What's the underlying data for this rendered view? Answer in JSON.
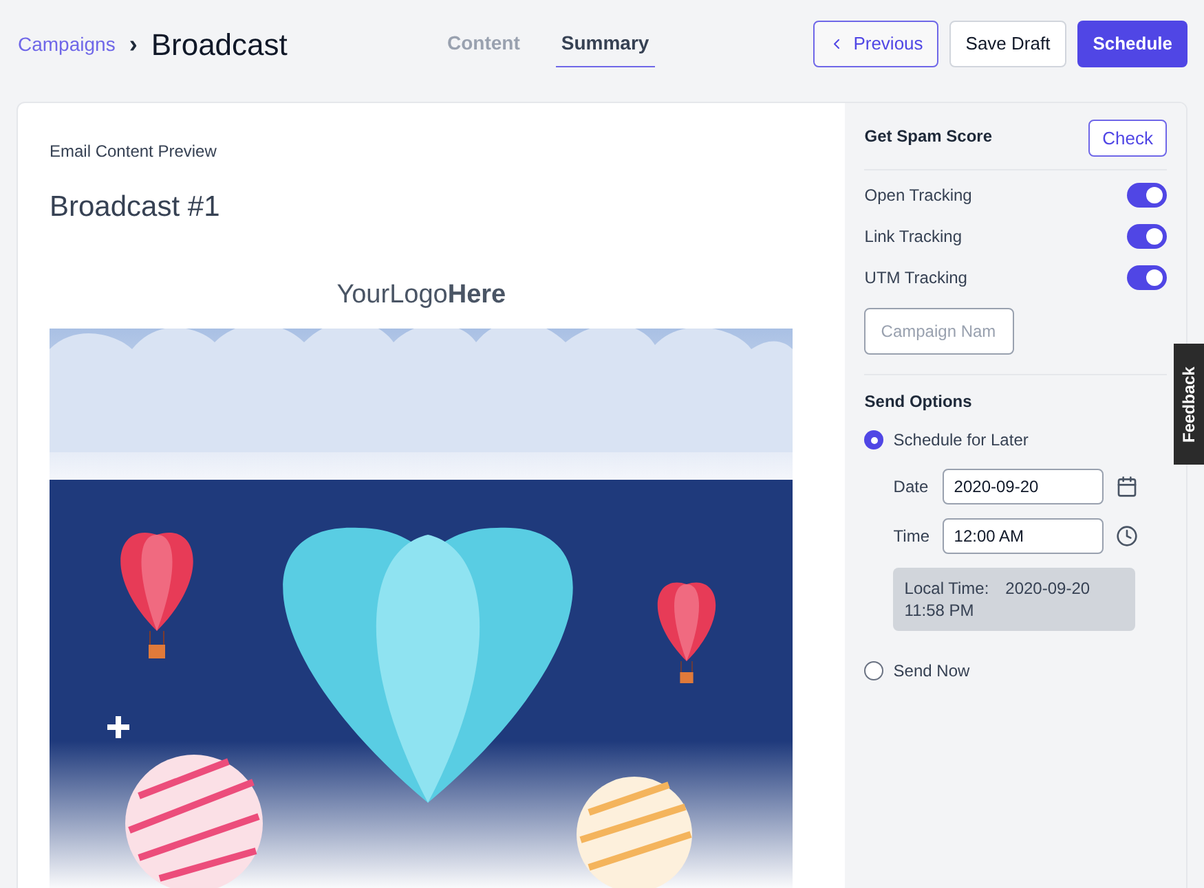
{
  "breadcrumb": {
    "parent": "Campaigns",
    "separator": "›",
    "current": "Broadcast"
  },
  "tabs": [
    {
      "label": "Content",
      "selected": false
    },
    {
      "label": "Summary",
      "selected": true
    }
  ],
  "actions": {
    "previous": "Previous",
    "save_draft": "Save Draft",
    "schedule": "Schedule"
  },
  "preview": {
    "heading": "Email Content Preview",
    "title": "Broadcast #1",
    "logo": "YourLogo**Here**"
  },
  "sidebar": {
    "spam_score": {
      "label": "Get Spam Score",
      "button": "Check"
    },
    "toggles": [
      {
        "label": "Open Tracking",
        "on": true
      },
      {
        "label": "Link Tracking",
        "on": true
      },
      {
        "label": "UTM Tracking",
        "on": true
      }
    ],
    "campaign_field": {
      "placeholder": "Campaign Nam"
    },
    "send_options": {
      "title": "Send Options",
      "options": [
        {
          "label": "Schedule for Later",
          "selected": true
        },
        {
          "label": "Send Now",
          "selected": false
        }
      ],
      "date": {
        "label": "Date",
        "value": "2020-09-20"
      },
      "time": {
        "label": "Time",
        "value": "12:00 AM"
      },
      "local_time": {
        "label": "Local Time:",
        "date": "2020-09-20",
        "time": "11:58 PM"
      }
    }
  },
  "feedback": "Feedback"
}
